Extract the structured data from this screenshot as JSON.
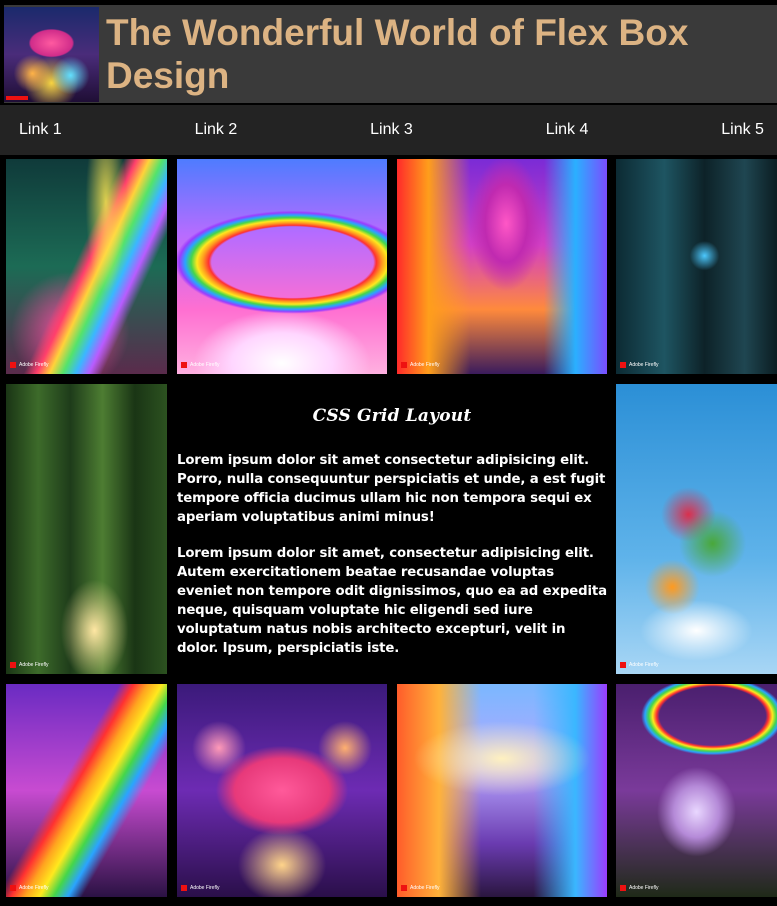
{
  "header": {
    "title": "The Wonderful World of Flex Box Design",
    "logo_icon": "mushroom-logo"
  },
  "nav": {
    "links": [
      "Link 1",
      "Link 2",
      "Link 3",
      "Link 4",
      "Link 5"
    ]
  },
  "main": {
    "heading": "CSS Grid Layout",
    "paragraphs": [
      "Lorem ipsum dolor sit amet consectetur adipisicing elit. Porro, nulla consequuntur perspiciatis et unde, a est fugit tempore officia ducimus ullam hic non tempora sequi ex aperiam voluptatibus animi minus!",
      "Lorem ipsum dolor sit amet, consectetur adipisicing elit. Autem exercitationem beatae recusandae voluptas eveniet non tempore odit dignissimos, quo ea ad expedita neque, quisquam voluptate hic eligendi sed iure voluptatum natus nobis architecto excepturi, velit in dolor. Ipsum, perspiciatis iste."
    ]
  },
  "gallery": {
    "badge_text": "Adobe Firefly",
    "images": [
      "rainbow-forest-image",
      "rainbow-city-image",
      "rainbow-spires-image",
      "cyber-city-robot-image",
      "misty-forest-image",
      "fruit-cloud-image",
      "rainbow-angel-image",
      "mushroom-house-image",
      "fantasy-castle-image",
      "unicorn-forest-image"
    ]
  },
  "colors": {
    "title": "#dcb383",
    "header_bg": "#3a3a3a",
    "nav_bg": "#232323",
    "page_bg": "#000000"
  }
}
